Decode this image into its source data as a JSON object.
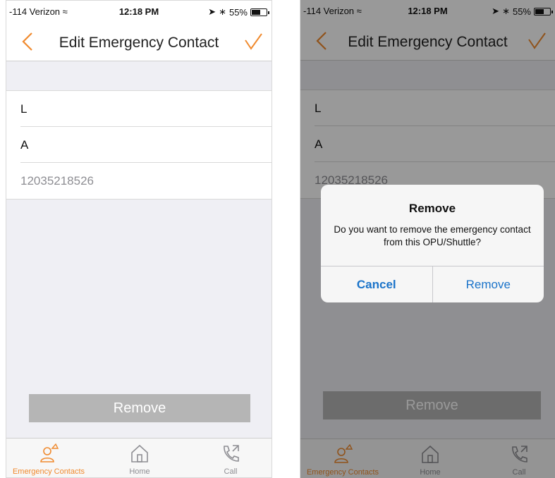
{
  "status_bar": {
    "carrier": "-114 Verizon",
    "time": "12:18 PM",
    "battery": "55%"
  },
  "nav": {
    "title": "Edit Emergency Contact",
    "back_icon": "chevron-left-icon",
    "done_icon": "checkmark-icon"
  },
  "contact": {
    "first_name": "L",
    "last_name": "A",
    "phone": "12035218526"
  },
  "remove_button": "Remove",
  "tabs": [
    {
      "label": "Emergency Contacts",
      "icon": "emergency-contact-icon",
      "active": true
    },
    {
      "label": "Home",
      "icon": "home-icon",
      "active": false
    },
    {
      "label": "Call",
      "icon": "phone-call-icon",
      "active": false
    }
  ],
  "dialog": {
    "title": "Remove",
    "message": "Do you want to remove the emergency contact from this OPU/Shuttle?",
    "cancel": "Cancel",
    "confirm": "Remove"
  },
  "colors": {
    "accent": "#f08a2e",
    "dialog_button": "#1a73c9",
    "disabled_button": "#b5b5b5"
  }
}
